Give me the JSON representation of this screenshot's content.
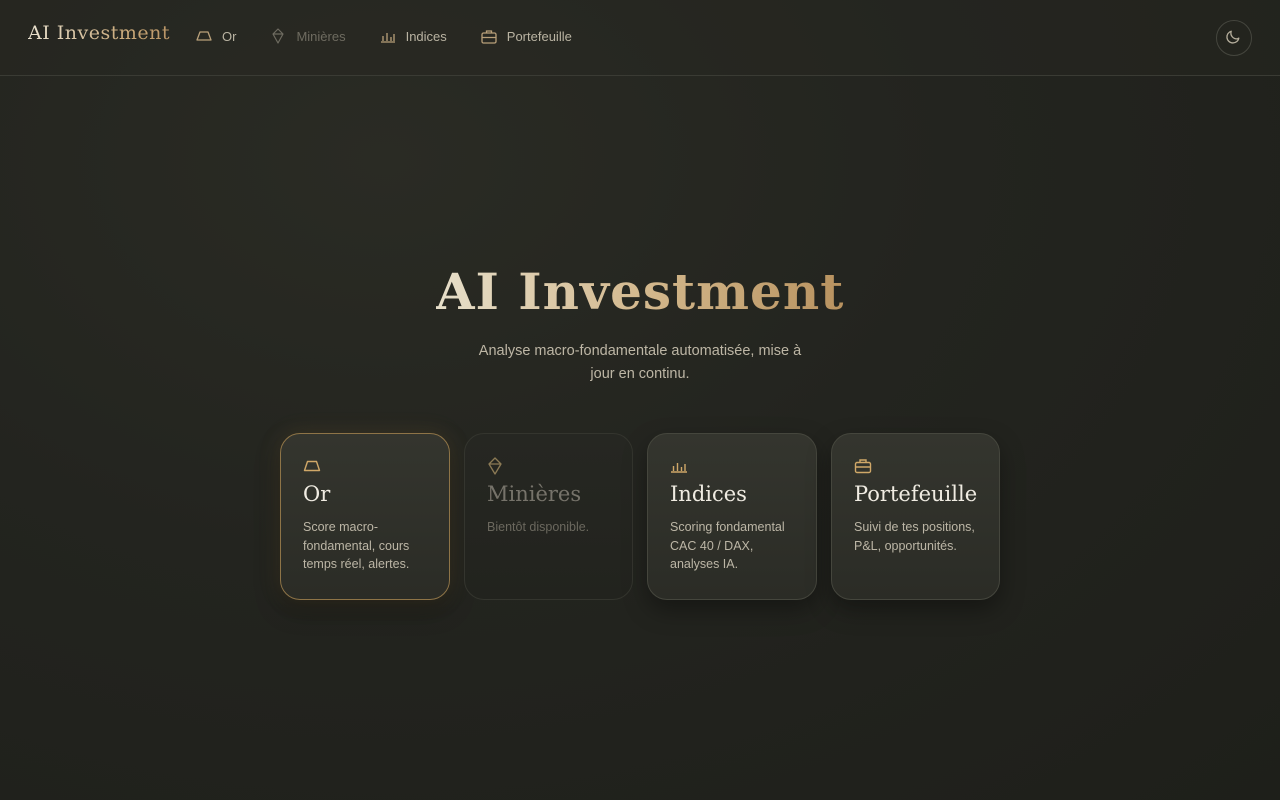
{
  "app": {
    "brand": "AI Investment"
  },
  "nav": {
    "items": [
      {
        "label": "Or",
        "icon": "gold-bar-icon",
        "disabled": false
      },
      {
        "label": "Minières",
        "icon": "gem-icon",
        "disabled": true
      },
      {
        "label": "Indices",
        "icon": "bar-chart-icon",
        "disabled": false
      },
      {
        "label": "Portefeuille",
        "icon": "briefcase-icon",
        "disabled": false
      }
    ],
    "theme_toggle_icon": "moon-icon"
  },
  "hero": {
    "title": "AI Investment",
    "subtitle": "Analyse macro-fondamentale automatisée, mise à jour en continu."
  },
  "cards": [
    {
      "title": "Or",
      "description": "Score macro-fondamental, cours temps réel, alertes.",
      "icon": "gold-bar-icon",
      "state": "active"
    },
    {
      "title": "Minières",
      "description": "Bientôt disponible.",
      "icon": "gem-icon",
      "state": "disabled"
    },
    {
      "title": "Indices",
      "description": "Scoring fondamental CAC 40 / DAX, analyses IA.",
      "icon": "bar-chart-icon",
      "state": "normal"
    },
    {
      "title": "Portefeuille",
      "description": "Suivi de tes positions, P&L, opportunités.",
      "icon": "briefcase-icon",
      "state": "normal"
    }
  ],
  "colors": {
    "accent_gold": "#c9a878",
    "background": "#23241f",
    "card": "#30312b"
  }
}
